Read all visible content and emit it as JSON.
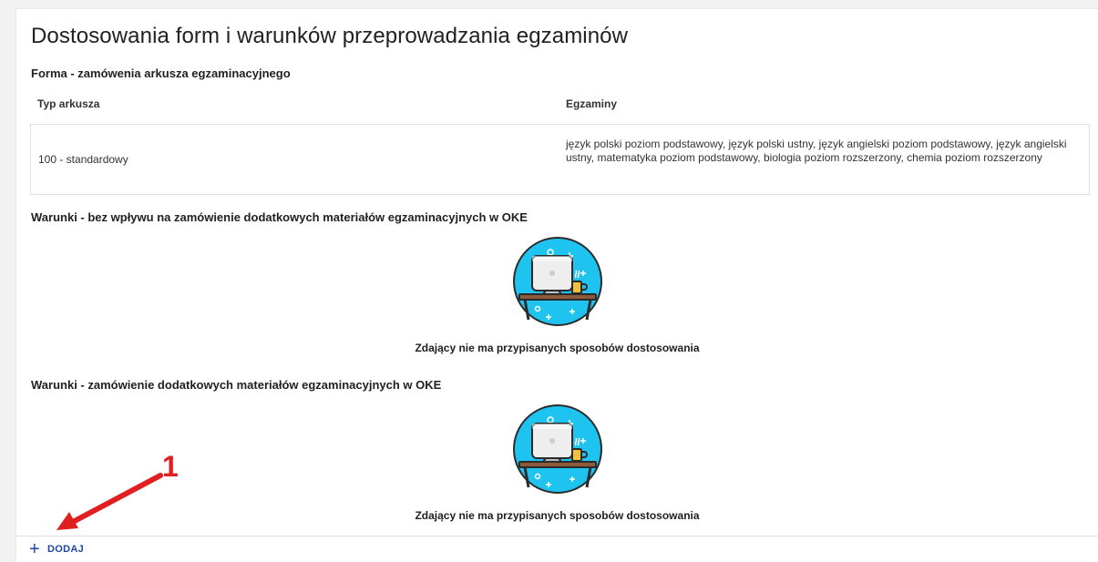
{
  "page": {
    "title": "Dostosowania form i warunków przeprowadzania egzaminów"
  },
  "forma": {
    "section_title": "Forma - zamówenia arkusza egzaminacyjnego",
    "columns": [
      "Typ arkusza",
      "Egzaminy"
    ],
    "rows": [
      {
        "typ": "100 - standardowy",
        "egzaminy": "język polski poziom podstawowy, język polski ustny, język angielski poziom podstawowy, język angielski ustny, matematyka poziom podstawowy, biologia poziom rozszerzony, chemia poziom rozszerzony"
      }
    ]
  },
  "warunki1": {
    "section_title": "Warunki - bez wpływu na zamówienie dodatkowych materiałów egzaminacyjnych w OKE",
    "empty_text": "Zdający nie ma przypisanych sposobów dostosowania",
    "illustration_icon": "computer-desk-icon"
  },
  "warunki2": {
    "section_title": "Warunki - zamówienie dodatkowych materiałów egzaminacyjnych w OKE",
    "empty_text": "Zdający nie ma przypisanych sposobów dostosowania",
    "illustration_icon": "computer-desk-icon"
  },
  "footer": {
    "add_label": "DODAJ",
    "add_icon": "plus-icon"
  },
  "annotation": {
    "number": "1",
    "color": "#e02020"
  },
  "colors": {
    "accent": "#1e45a8",
    "illustration_bg": "#1fc3f0",
    "desk": "#8d5a3b",
    "mug": "#f5c13a"
  }
}
